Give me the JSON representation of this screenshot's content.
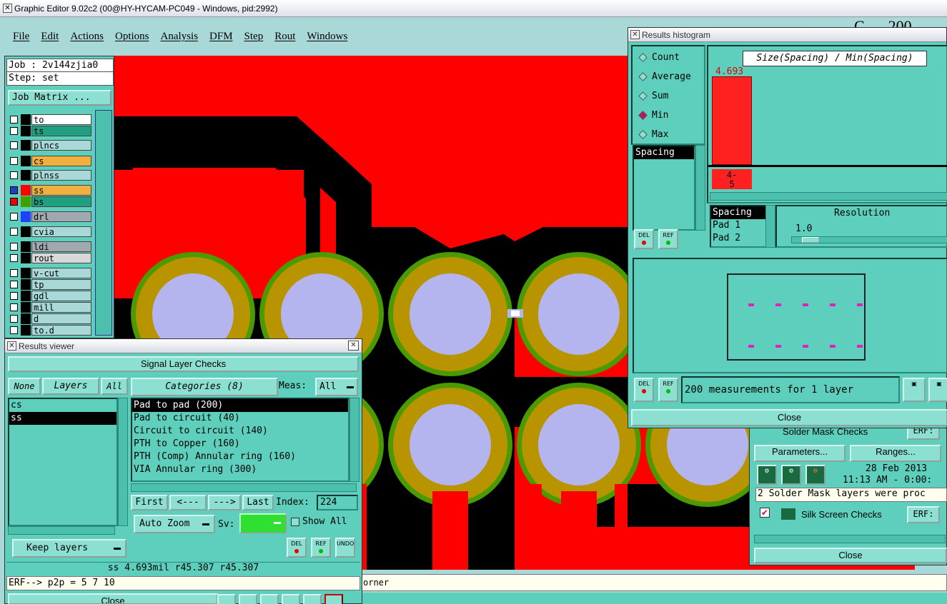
{
  "window": {
    "title": "Graphic Editor 9.02c2 (00@HY-HYCAM-PC049 - Windows, pid:2992)",
    "brand_partial": "C..... 200"
  },
  "menu": [
    "File",
    "Edit",
    "Actions",
    "Options",
    "Analysis",
    "DFM",
    "Step",
    "Rout",
    "Windows"
  ],
  "left": {
    "job": "Job : 2v144zjia0",
    "step": "Step: set",
    "job_matrix": "Job Matrix ...",
    "layers": [
      {
        "name": "to",
        "bg": "#ffffff",
        "swatch": "#000000"
      },
      {
        "name": "ts",
        "bg": "#20a080",
        "swatch": "#000000"
      },
      {
        "name": "plncs",
        "bg": "#a8d8d8",
        "swatch": "#000000"
      },
      {
        "name": "cs",
        "bg": "#f0b040",
        "swatch": "#000000"
      },
      {
        "name": "plnss",
        "bg": "#a8d8d8",
        "swatch": "#000000"
      },
      {
        "name": "ss",
        "bg": "#f0b040",
        "swatch": "#ff0000"
      },
      {
        "name": "bs",
        "bg": "#20a080",
        "swatch": "#40a000"
      },
      {
        "name": "drl",
        "bg": "#a0a8b0",
        "swatch": "#2040ff"
      },
      {
        "name": "cvia",
        "bg": "#a8d8d8",
        "swatch": "#000000"
      },
      {
        "name": "ldi",
        "bg": "#a0a8b0",
        "swatch": "#000000"
      },
      {
        "name": "rout",
        "bg": "#d8d8d8",
        "swatch": "#000000"
      },
      {
        "name": "v-cut",
        "bg": "#a8d8d8",
        "swatch": "#000000"
      },
      {
        "name": "tp",
        "bg": "#a8d8d8",
        "swatch": "#000000"
      },
      {
        "name": "gdl",
        "bg": "#a8d8d8",
        "swatch": "#000000"
      },
      {
        "name": "mill",
        "bg": "#a8d8d8",
        "swatch": "#000000"
      },
      {
        "name": "d",
        "bg": "#a8d8d8",
        "swatch": "#000000"
      },
      {
        "name": "to.d",
        "bg": "#a8d8d8",
        "swatch": "#000000"
      }
    ]
  },
  "viewer": {
    "title": "Results viewer",
    "header": "Signal Layer Checks",
    "none": "None",
    "layers": "Layers",
    "all": "All",
    "categories_label": "Categories (8)",
    "meas_label": "Meas:",
    "meas_value": "All",
    "layer_items": [
      "cs",
      "ss"
    ],
    "category_items": [
      "Pad to pad (200)",
      "Pad to circuit (40)",
      "Circuit to circuit (140)",
      "PTH to Copper (160)",
      "PTH (Comp) Annular ring (160)",
      "VIA Annular ring (300)"
    ],
    "first": "First",
    "prev": "<---",
    "next": "--->",
    "last": "Last",
    "index_label": "Index:",
    "index_value": "224",
    "auto_zoom": "Auto Zoom",
    "sv_label": "Sv:",
    "show_all": "Show All",
    "keep_layers": "Keep layers",
    "del": "DEL",
    "ref": "REF",
    "undo": "UNDO",
    "result_line": "ss 4.693mil  r45.307  r45.307",
    "erf_line": "ERF--> p2p = 5 7 10",
    "close": "Close"
  },
  "status_text": "orner",
  "histogram": {
    "title": "Results histogram",
    "modes": [
      "Count",
      "Average",
      "Sum",
      "Min",
      "Max"
    ],
    "selected_mode": "Min",
    "chart_title": "Size(Spacing) / Min(Spacing)",
    "bar_value": "4.693",
    "bin_label_1": "4-",
    "bin_label_2": "5",
    "spacing_list": [
      "Spacing"
    ],
    "field_list": [
      "Spacing",
      "Pad 1",
      "Pad 2"
    ],
    "resolution_label": "Resolution",
    "resolution_value": "1.0",
    "measurements": "200 measurements for 1 layer",
    "close": "Close"
  },
  "back_panel": {
    "solder_mask": "Solder Mask Checks",
    "erf": "ERF:",
    "parameters": "Parameters...",
    "ranges": "Ranges...",
    "date": "28 Feb 2013",
    "time": "11:13 AM - 0:00:",
    "message": "2 Solder Mask layers were proc",
    "silk": "Silk Screen Checks",
    "close": "Close"
  },
  "colors": {
    "panel": "#5fcfbd",
    "button": "#8be0d2",
    "copper": "#ff0000",
    "pad_ring": "#b89400",
    "pad_outer": "#4a9a00",
    "drill": "#b4b4ee"
  }
}
